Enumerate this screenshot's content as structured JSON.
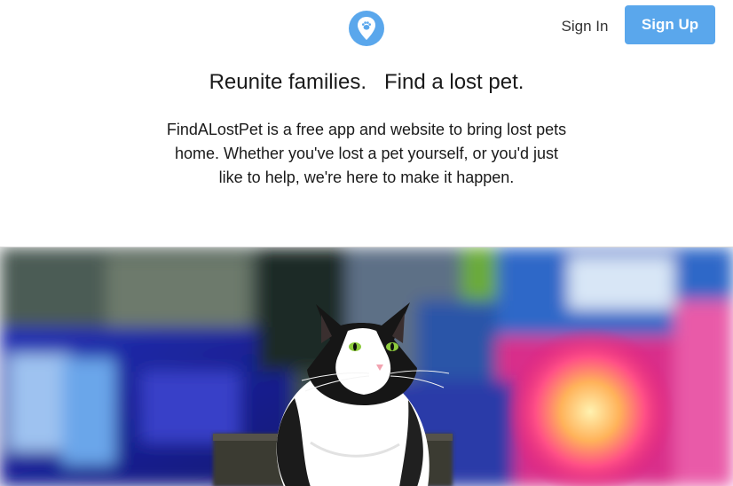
{
  "header": {
    "logo_icon": "paw-location-pin-icon",
    "signin_label": "Sign In",
    "signup_label": "Sign Up",
    "accent_color": "#5aa7ec"
  },
  "hero": {
    "headline": "Reunite families.   Find a lost pet.",
    "description": "FindALostPet is a free app and website to bring lost pets home. Whether you've lost a pet yourself, or you'd just like to help, we're here to make it happen."
  },
  "hero_image": {
    "subject": "black-and-white-cat-graffiti-photo"
  }
}
